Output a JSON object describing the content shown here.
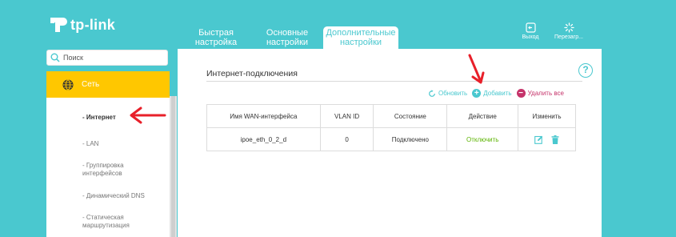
{
  "logo": {
    "text": "tp-link"
  },
  "nav": {
    "tabs": [
      {
        "label": "Быстрая настройка"
      },
      {
        "label": "Основные настройки"
      },
      {
        "label": "Дополнительные настройки"
      }
    ],
    "exit_label": "Выход",
    "reboot_label": "Перезагр..."
  },
  "sidebar": {
    "search_placeholder": "Поиск",
    "section_label": "Сеть",
    "items": [
      {
        "label": "- Интернет"
      },
      {
        "label": "- LAN"
      },
      {
        "label": "- Группировка интерфейсов"
      },
      {
        "label": "- Динамический DNS"
      },
      {
        "label": "- Статическая маршрутизация"
      }
    ]
  },
  "main": {
    "title": "Интернет-подключения",
    "help_label": "?",
    "actions": {
      "refresh": "Обновить",
      "add": "Добавить",
      "delete_all": "Удалить все"
    },
    "table": {
      "headers": [
        "Имя WAN-интерфейса",
        "VLAN ID",
        "Состояние",
        "Действие",
        "Изменить"
      ],
      "rows": [
        {
          "name": "ipoe_eth_0_2_d",
          "vlan": "0",
          "status": "Подключено",
          "action": "Отключить"
        }
      ]
    }
  },
  "colors": {
    "brand": "#4ac8cf",
    "section_bg": "#ffc700",
    "delete": "#c5336a",
    "action_green": "#5bb300",
    "arrow_red": "#e8202a"
  }
}
